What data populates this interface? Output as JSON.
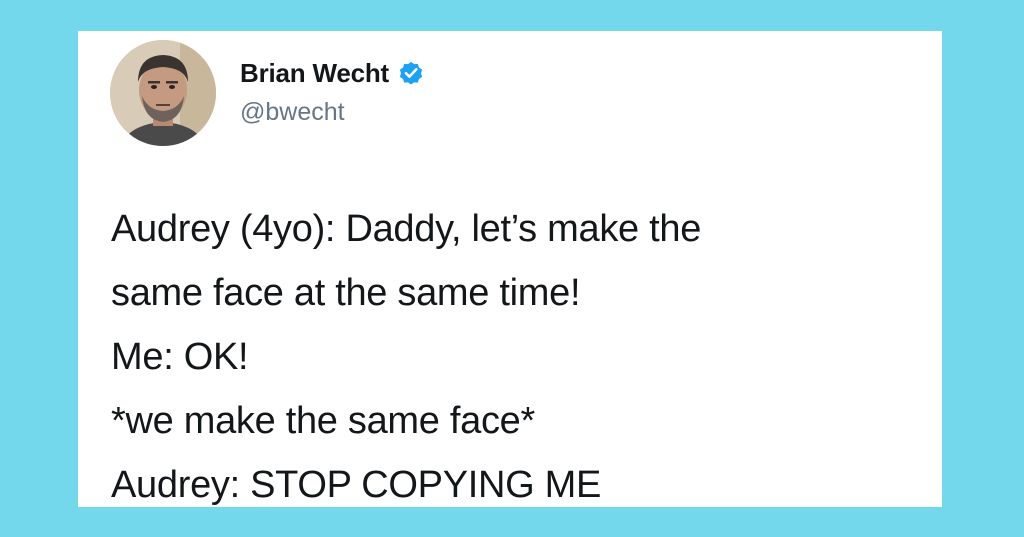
{
  "author": {
    "display_name": "Brian Wecht",
    "handle": "@bwecht",
    "verified": true,
    "avatar_icon": "avatar-photo"
  },
  "tweet": {
    "lines": [
      "Audrey (4yo): Daddy, let’s make the",
      "same face at the same time!",
      "Me: OK!",
      "*we make the same face*",
      "Audrey: STOP COPYING ME"
    ]
  },
  "colors": {
    "background": "#73d8ec",
    "card": "#ffffff",
    "text": "#14171a",
    "handle": "#657786",
    "verified_badge": "#1da1f2"
  }
}
